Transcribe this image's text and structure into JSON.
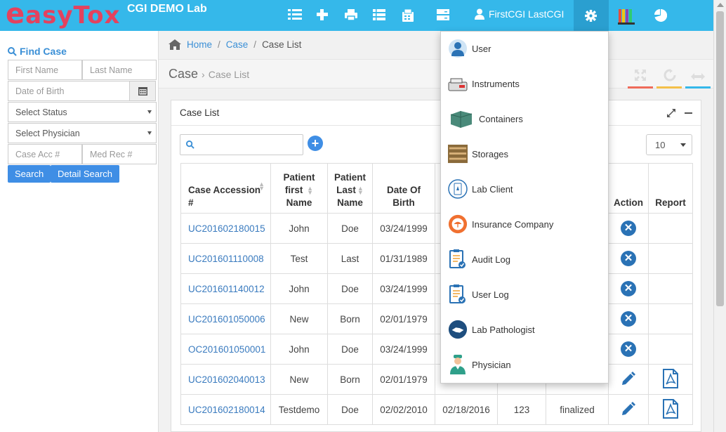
{
  "app": {
    "logo_text": "EasyTox",
    "lab_name": "CGI DEMO Lab",
    "user_name": "FirstCGI LastCGI",
    "accent_color": "#35b8ea",
    "brand_color": "#e3425e"
  },
  "sidebar": {
    "title": "Find Case",
    "first_name_placeholder": "First Name",
    "last_name_placeholder": "Last Name",
    "dob_placeholder": "Date of Birth",
    "status_select": "Select Status",
    "physician_select": "Select Physician",
    "case_acc_placeholder": "Case Acc #",
    "med_rec_placeholder": "Med Rec #",
    "search_button": "Search",
    "detail_search_button": "Detail Search"
  },
  "breadcrumb": {
    "home": "Home",
    "case": "Case",
    "current": "Case List",
    "sep": "/"
  },
  "page": {
    "title": "Case",
    "subtitle": "Case List",
    "arrow": "›"
  },
  "panel": {
    "title": "Case List",
    "page_size": "10"
  },
  "table": {
    "headers": {
      "accession": "Case Accession #",
      "first_name": [
        "Patient",
        "first",
        "Name"
      ],
      "last_name": [
        "Patient",
        "Last",
        "Name"
      ],
      "dob": [
        "Date Of",
        "Birth"
      ],
      "action": "Action",
      "report": "Report"
    },
    "rows": [
      {
        "accession": "UC201602180015",
        "first": "John",
        "last": "Doe",
        "dob": "03/24/1999",
        "action": "delete",
        "report": ""
      },
      {
        "accession": "UC201601110008",
        "first": "Test",
        "last": "Last",
        "dob": "01/31/1989",
        "action": "delete",
        "report": ""
      },
      {
        "accession": "UC201601140012",
        "first": "John",
        "last": "Doe",
        "dob": "03/24/1999",
        "action": "delete",
        "report": ""
      },
      {
        "accession": "UC201601050006",
        "first": "New",
        "last": "Born",
        "dob": "02/01/1979",
        "action": "delete",
        "report": ""
      },
      {
        "accession": "OC201601050001",
        "first": "John",
        "last": "Doe",
        "dob": "03/24/1999",
        "action": "delete",
        "report": ""
      },
      {
        "accession": "UC201602040013",
        "first": "New",
        "last": "Born",
        "dob": "02/01/1979",
        "action": "edit",
        "report": "pdf"
      },
      {
        "accession": "UC201602180014",
        "first": "Testdemo",
        "last": "Doe",
        "dob": "02/02/2010",
        "collected": "02/18/2016",
        "count": "123",
        "status": "finalized",
        "action": "edit",
        "report": "pdf"
      }
    ]
  },
  "dropdown": {
    "items": [
      {
        "label": "User",
        "icon": "user-icon"
      },
      {
        "label": "Instruments",
        "icon": "instrument-icon"
      },
      {
        "label": "Containers",
        "icon": "container-icon"
      },
      {
        "label": "Storages",
        "icon": "storage-icon"
      },
      {
        "label": "Lab Client",
        "icon": "lab-client-icon"
      },
      {
        "label": "Insurance Company",
        "icon": "insurance-icon"
      },
      {
        "label": "Audit Log",
        "icon": "audit-log-icon"
      },
      {
        "label": "User Log",
        "icon": "user-log-icon"
      },
      {
        "label": "Lab Pathologist",
        "icon": "pathologist-icon"
      },
      {
        "label": "Physician",
        "icon": "physician-icon"
      }
    ]
  }
}
